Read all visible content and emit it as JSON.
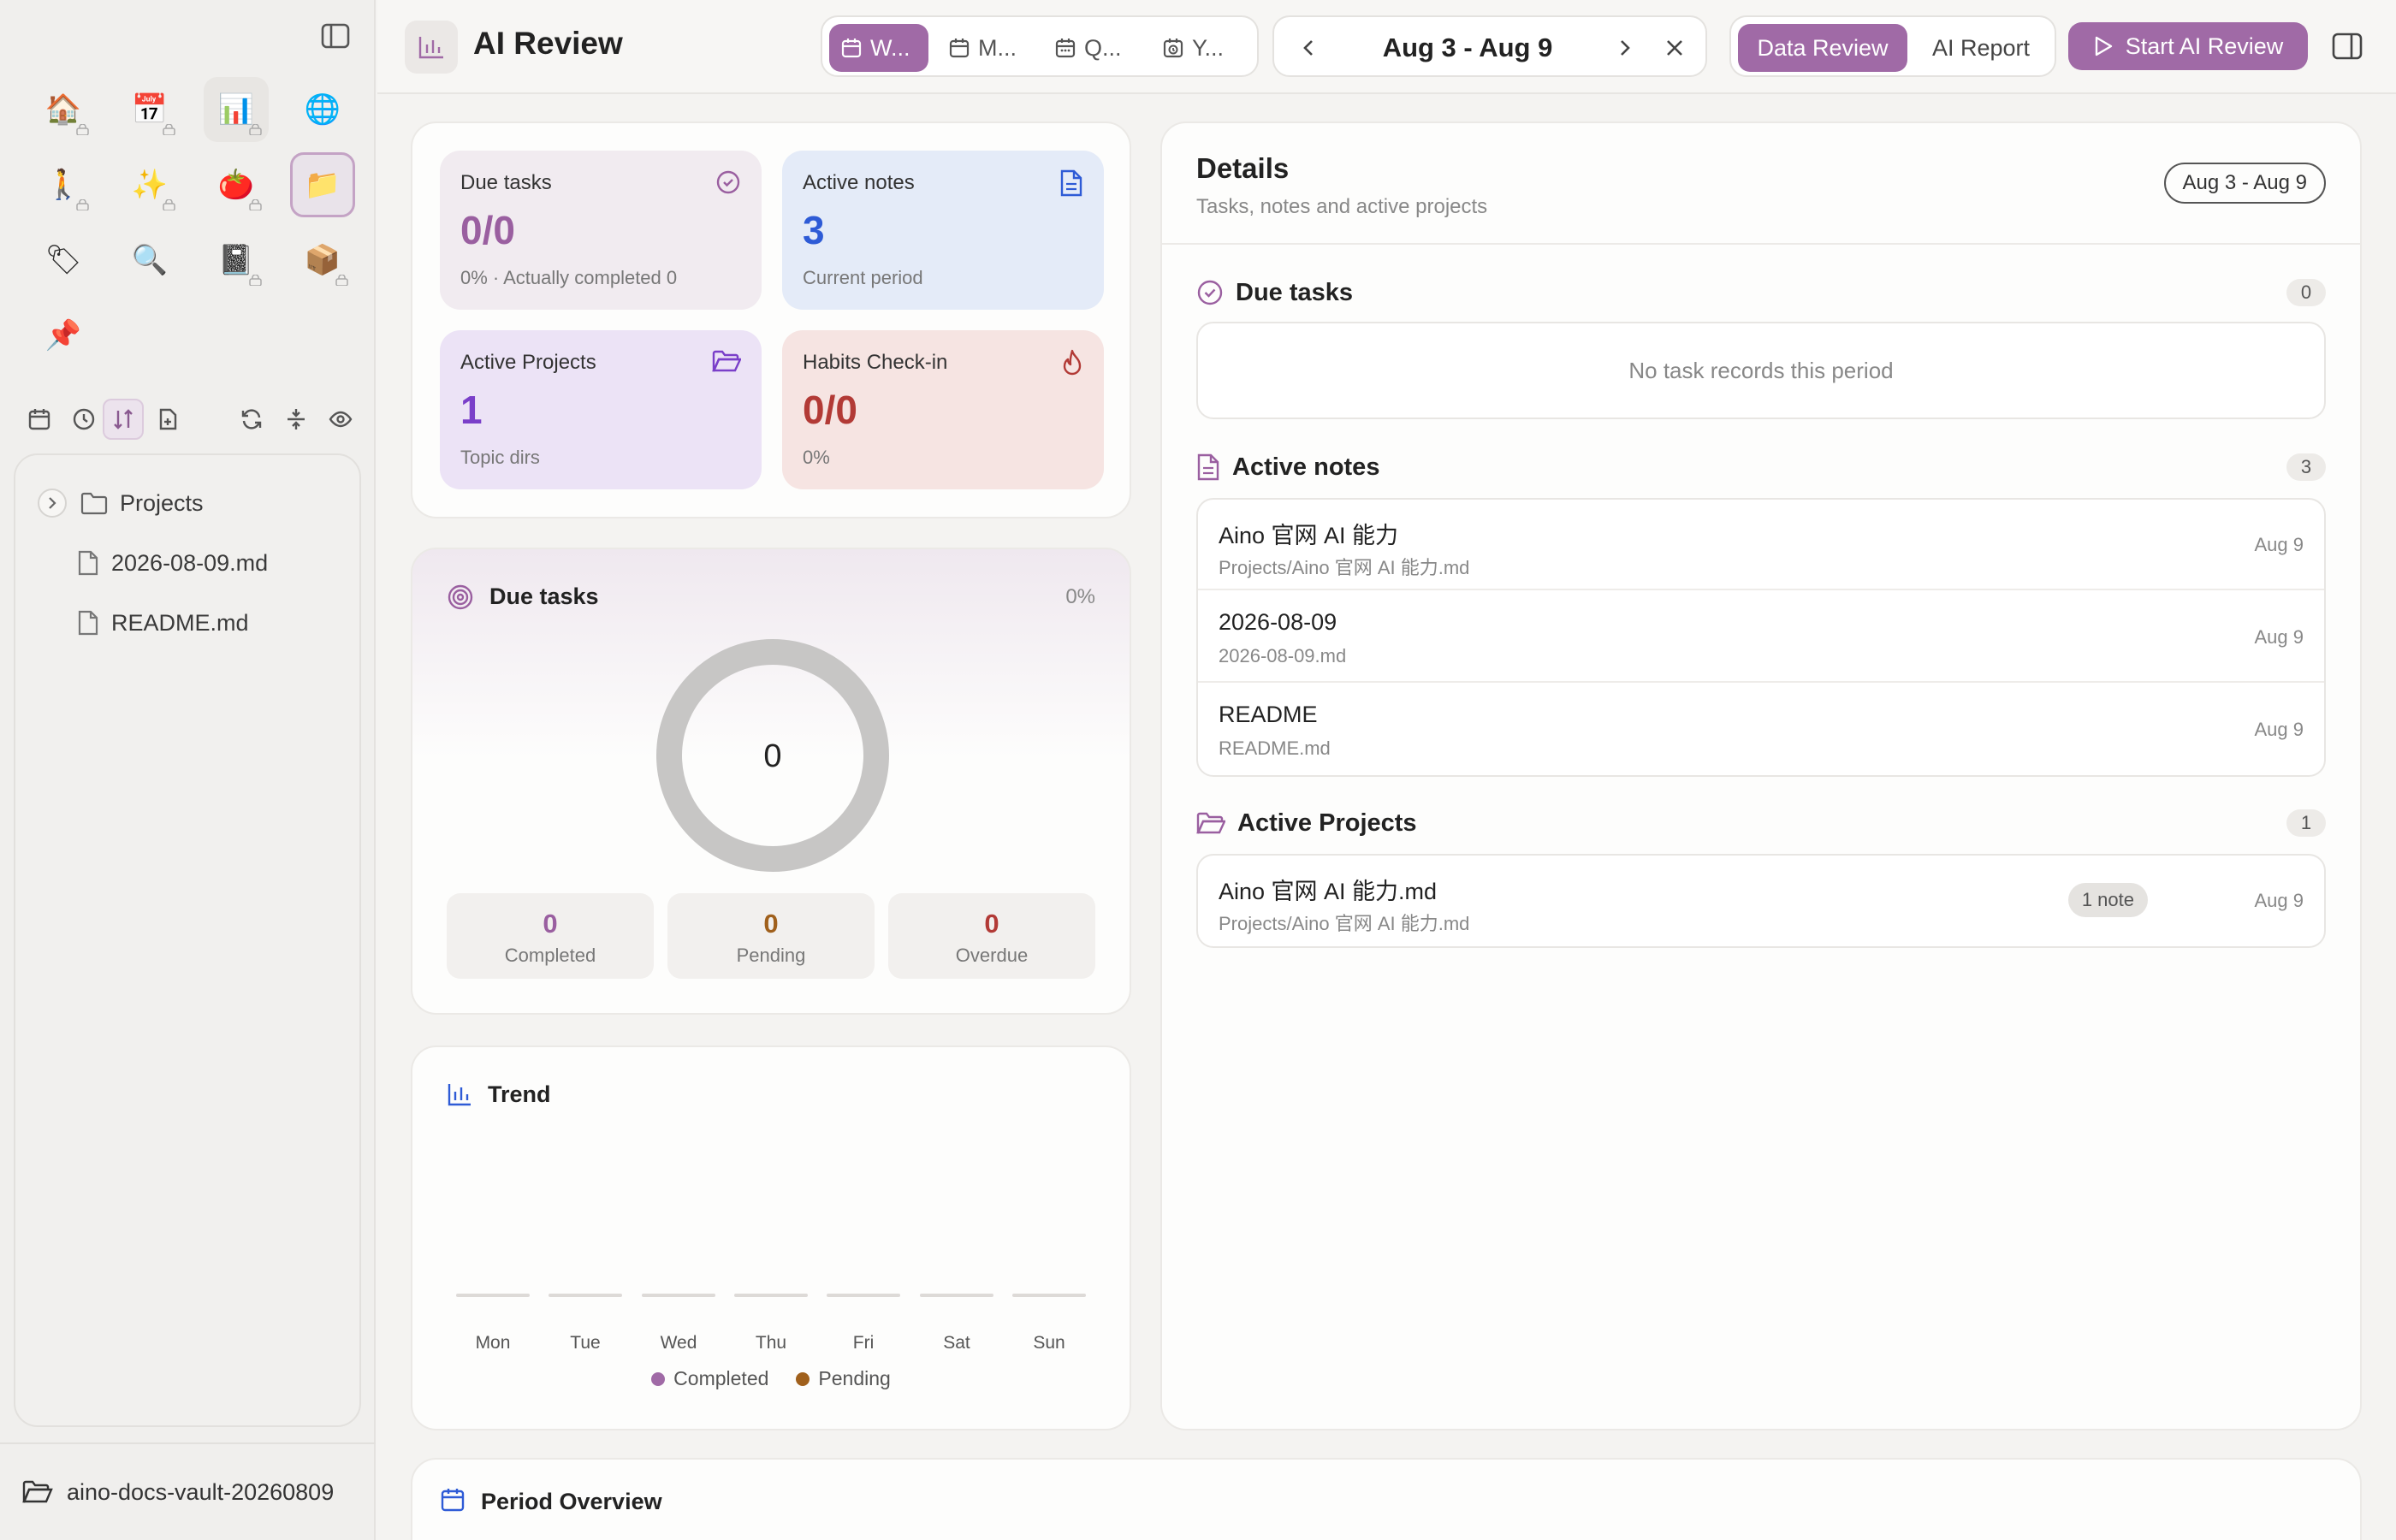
{
  "sidebar": {
    "apps": [
      {
        "id": "home",
        "glyph": "🏠",
        "locked": true
      },
      {
        "id": "calendar",
        "glyph": "📅",
        "locked": true
      },
      {
        "id": "review",
        "glyph": "📊",
        "locked": true
      },
      {
        "id": "web",
        "glyph": "🌐",
        "locked": false
      },
      {
        "id": "walk",
        "glyph": "🚶",
        "locked": true
      },
      {
        "id": "sparkles",
        "glyph": "✨",
        "locked": true
      },
      {
        "id": "tomato",
        "glyph": "🍅",
        "locked": true
      },
      {
        "id": "files",
        "glyph": "📁",
        "locked": false
      },
      {
        "id": "tag",
        "glyph": "🏷",
        "locked": false
      },
      {
        "id": "search",
        "glyph": "🔍",
        "locked": false
      },
      {
        "id": "notebook",
        "glyph": "📓",
        "locked": true
      },
      {
        "id": "box",
        "glyph": "📦",
        "locked": true
      },
      {
        "id": "pushpin",
        "glyph": "📌",
        "locked": false
      }
    ],
    "tree": {
      "folder": "Projects",
      "files": [
        "2026-08-09.md",
        "README.md"
      ]
    },
    "vault_name": "aino-docs-vault-20260809"
  },
  "header": {
    "title": "AI Review",
    "period_tabs": [
      "W...",
      "M...",
      "Q...",
      "Y..."
    ],
    "date_range": "Aug 3 - Aug 9",
    "view_tabs": [
      "Data Review",
      "AI Report"
    ],
    "start_label": "Start AI Review"
  },
  "colors": {
    "accent": "#a06aa6",
    "blue": "#2e5bd6",
    "purple": "#7a3fc9",
    "red": "#b23a36",
    "amber": "#a0601c"
  },
  "stats": {
    "due": {
      "label": "Due tasks",
      "value": "0/0",
      "sub": "0% · Actually completed 0"
    },
    "notes": {
      "label": "Active notes",
      "value": "3",
      "sub": "Current period"
    },
    "projects": {
      "label": "Active Projects",
      "value": "1",
      "sub": "Topic dirs"
    },
    "habits": {
      "label": "Habits Check-in",
      "value": "0/0",
      "sub": "0%"
    }
  },
  "due_panel": {
    "title": "Due tasks",
    "percent": "0%",
    "center": "0",
    "completion": 0,
    "completed": {
      "value": "0",
      "label": "Completed"
    },
    "pending": {
      "value": "0",
      "label": "Pending"
    },
    "overdue": {
      "value": "0",
      "label": "Overdue"
    }
  },
  "trend": {
    "title": "Trend",
    "days": [
      "Mon",
      "Tue",
      "Wed",
      "Thu",
      "Fri",
      "Sat",
      "Sun"
    ],
    "completed": [
      0,
      0,
      0,
      0,
      0,
      0,
      0
    ],
    "pending": [
      0,
      0,
      0,
      0,
      0,
      0,
      0
    ],
    "legend": [
      "Completed",
      "Pending"
    ]
  },
  "details": {
    "title": "Details",
    "subtitle": "Tasks, notes and active projects",
    "range": "Aug 3 - Aug 9",
    "due": {
      "title": "Due tasks",
      "count": "0",
      "empty": "No task records this period"
    },
    "notes": {
      "title": "Active notes",
      "count": "3",
      "items": [
        {
          "title": "Aino 官网 AI 能力",
          "path": "Projects/Aino 官网 AI 能力.md",
          "date": "Aug 9"
        },
        {
          "title": "2026-08-09",
          "path": "2026-08-09.md",
          "date": "Aug 9"
        },
        {
          "title": "README",
          "path": "README.md",
          "date": "Aug 9"
        }
      ]
    },
    "projects": {
      "title": "Active Projects",
      "count": "1",
      "items": [
        {
          "title": "Aino 官网 AI 能力.md",
          "path": "Projects/Aino 官网 AI 能力.md",
          "tag": "1 note",
          "date": "Aug 9"
        }
      ]
    }
  },
  "overview": {
    "title": "Period Overview"
  }
}
